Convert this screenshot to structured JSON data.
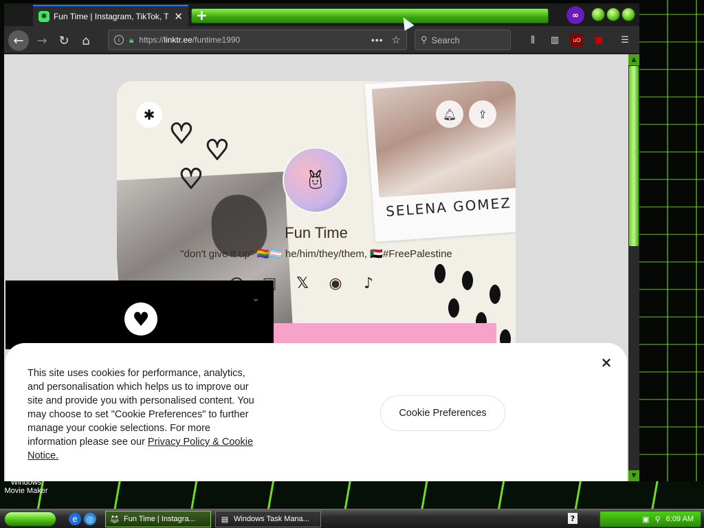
{
  "browser": {
    "tab": {
      "title": "Fun Time | Instagram, TikTok, Twitch",
      "favicon": "linktree-icon"
    },
    "new_tab_label": "+",
    "url": {
      "prefix": "https://",
      "domain": "linktr.ee",
      "path": "/funtime1990"
    },
    "search_placeholder": "Search",
    "accent": "#0a84ff"
  },
  "linktree": {
    "name": "Fun Time",
    "bio": "\"don't give it up\" 🏳️‍🌈🏳️‍⚧️ he/him/they/them, 🇸🇩#FreePalestine",
    "photo_caption": "SELENA GOMEZ",
    "socials": [
      "threads-icon",
      "twitch-icon",
      "x-icon",
      "github-icon",
      "tiktok-icon"
    ],
    "social_glyphs": [
      "@",
      "▣",
      "𝕏",
      "◉",
      "♪"
    ]
  },
  "cookie": {
    "text": "This site uses cookies for performance, analytics, and personalisation which helps us to improve our site and provide you with personalised content. You may choose to set \"Cookie Preferences\" to further manage your cookie selections. For more information please see our ",
    "link_text": "Privacy Policy & Cookie Notice.",
    "preferences_label": "Cookie Preferences",
    "close_label": "×"
  },
  "desktop": {
    "icon_label": "Windows Movie Maker"
  },
  "taskbar": {
    "tasks": [
      {
        "label": "Fun Time | Instagra...",
        "active": true
      },
      {
        "label": "Windows Task Mana...",
        "active": false
      }
    ],
    "clock": "6:09 AM"
  }
}
